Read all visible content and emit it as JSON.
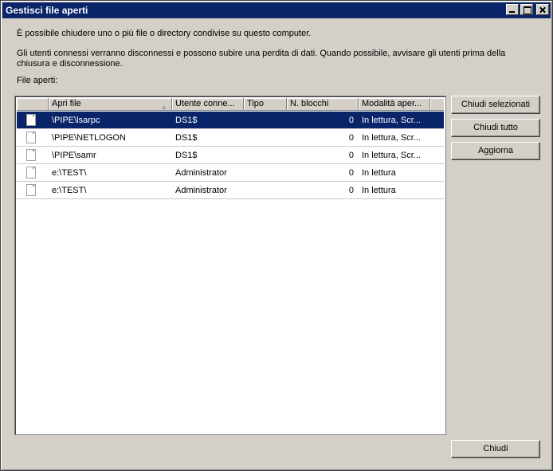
{
  "window": {
    "title": "Gestisci file aperti"
  },
  "intro": "È possibile chiudere uno o più file o directory condivise su questo computer.",
  "warning": "Gli utenti connessi verranno disconnessi e possono subire una perdita di dati. Quando possibile, avvisare gli utenti prima della chiusura e disconnessione.",
  "list_label": "File aperti:",
  "columns": [
    "",
    "Apri file",
    "Utente conne...",
    "Tipo",
    "N. blocchi",
    "Modalità aper...",
    ""
  ],
  "rows": [
    {
      "file": "\\PIPE\\lsarpc",
      "user": "DS1$",
      "type": "",
      "locks": "0",
      "mode": "In lettura, Scr...",
      "selected": true
    },
    {
      "file": "\\PIPE\\NETLOGON",
      "user": "DS1$",
      "type": "",
      "locks": "0",
      "mode": "In lettura, Scr...",
      "selected": false
    },
    {
      "file": "\\PIPE\\samr",
      "user": "DS1$",
      "type": "",
      "locks": "0",
      "mode": "In lettura, Scr...",
      "selected": false
    },
    {
      "file": "e:\\TEST\\",
      "user": "Administrator",
      "type": "",
      "locks": "0",
      "mode": "In lettura",
      "selected": false
    },
    {
      "file": "e:\\TEST\\",
      "user": "Administrator",
      "type": "",
      "locks": "0",
      "mode": "In lettura",
      "selected": false
    }
  ],
  "buttons": {
    "close_selected": "Chiudi selezionati",
    "close_all": "Chiudi tutto",
    "refresh": "Aggiorna",
    "close": "Chiudi"
  },
  "colors": {
    "title_bar": "#0a246a",
    "selection": "#0a246a",
    "face": "#d4d0c8"
  },
  "icons": {
    "file": "file-icon",
    "sort": "sort-ascending-icon"
  }
}
